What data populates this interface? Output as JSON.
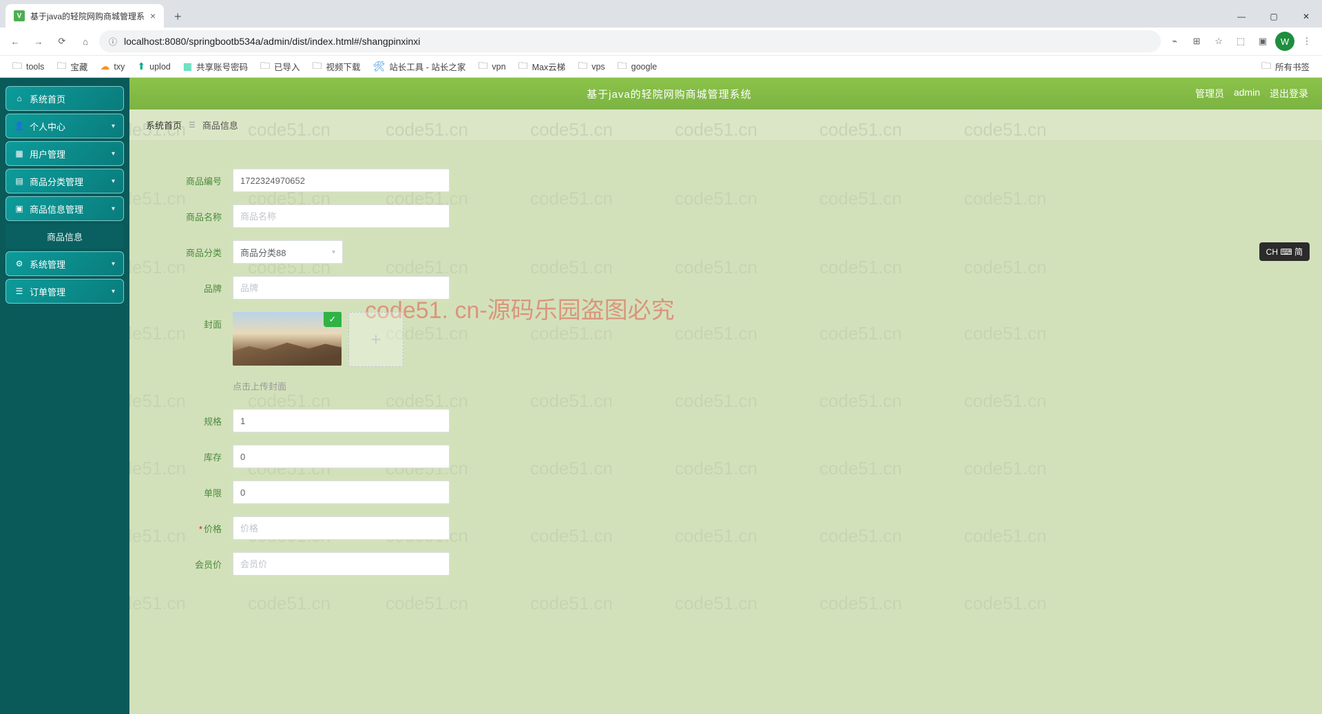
{
  "browser": {
    "tab_title": "基于java的轻院网购商城管理系",
    "url": "localhost:8080/springbootb534a/admin/dist/index.html#/shangpinxinxi",
    "new_tab": "+",
    "bookmarks": [
      {
        "icon": "folder",
        "label": "tools"
      },
      {
        "icon": "folder",
        "label": "宝藏"
      },
      {
        "icon": "cloud",
        "label": "txy",
        "color": "#f0932b"
      },
      {
        "icon": "up",
        "label": "uplod",
        "color": "#10ac84"
      },
      {
        "icon": "sheet",
        "label": "共享账号密码",
        "color": "#1dd1a1"
      },
      {
        "icon": "folder",
        "label": "已导入"
      },
      {
        "icon": "folder",
        "label": "视频下载"
      },
      {
        "icon": "tool",
        "label": "站长工具 - 站长之家",
        "color": "#2e86de"
      },
      {
        "icon": "folder",
        "label": "vpn"
      },
      {
        "icon": "folder",
        "label": "Max云梯"
      },
      {
        "icon": "folder",
        "label": "vps"
      },
      {
        "icon": "folder",
        "label": "google"
      }
    ],
    "bookmark_right": "所有书签",
    "profile_letter": "W"
  },
  "app": {
    "header_title": "基于java的轻院网购商城管理系统",
    "header_user_role": "管理员",
    "header_user_name": "admin",
    "header_logout": "退出登录",
    "sidebar": [
      {
        "icon": "home",
        "label": "系统首页",
        "sub": false,
        "expand": false
      },
      {
        "icon": "user",
        "label": "个人中心",
        "sub": false,
        "expand": true
      },
      {
        "icon": "grid",
        "label": "用户管理",
        "sub": false,
        "expand": true
      },
      {
        "icon": "category",
        "label": "商品分类管理",
        "sub": false,
        "expand": true
      },
      {
        "icon": "info",
        "label": "商品信息管理",
        "sub": false,
        "expand": true
      },
      {
        "icon": "",
        "label": "商品信息",
        "sub": true,
        "expand": false
      },
      {
        "icon": "gear",
        "label": "系统管理",
        "sub": false,
        "expand": true
      },
      {
        "icon": "order",
        "label": "订单管理",
        "sub": false,
        "expand": true
      }
    ],
    "breadcrumb": {
      "home": "系统首页",
      "current": "商品信息"
    },
    "form": {
      "product_id_label": "商品编号",
      "product_id_value": "1722324970652",
      "product_name_label": "商品名称",
      "product_name_placeholder": "商品名称",
      "category_label": "商品分类",
      "category_value": "商品分类88",
      "brand_label": "品牌",
      "brand_placeholder": "品牌",
      "cover_label": "封面",
      "upload_hint": "点击上传封面",
      "spec_label": "规格",
      "spec_value": "1",
      "stock_label": "库存",
      "stock_value": "0",
      "limit_label": "单限",
      "limit_value": "0",
      "price_label": "价格",
      "price_placeholder": "价格",
      "member_price_label": "会员价",
      "member_price_placeholder": "会员价"
    }
  },
  "watermark": {
    "text": "code51.cn",
    "warning": "code51. cn-源码乐园盗图必究"
  },
  "ime": "CH ⌨ 简"
}
